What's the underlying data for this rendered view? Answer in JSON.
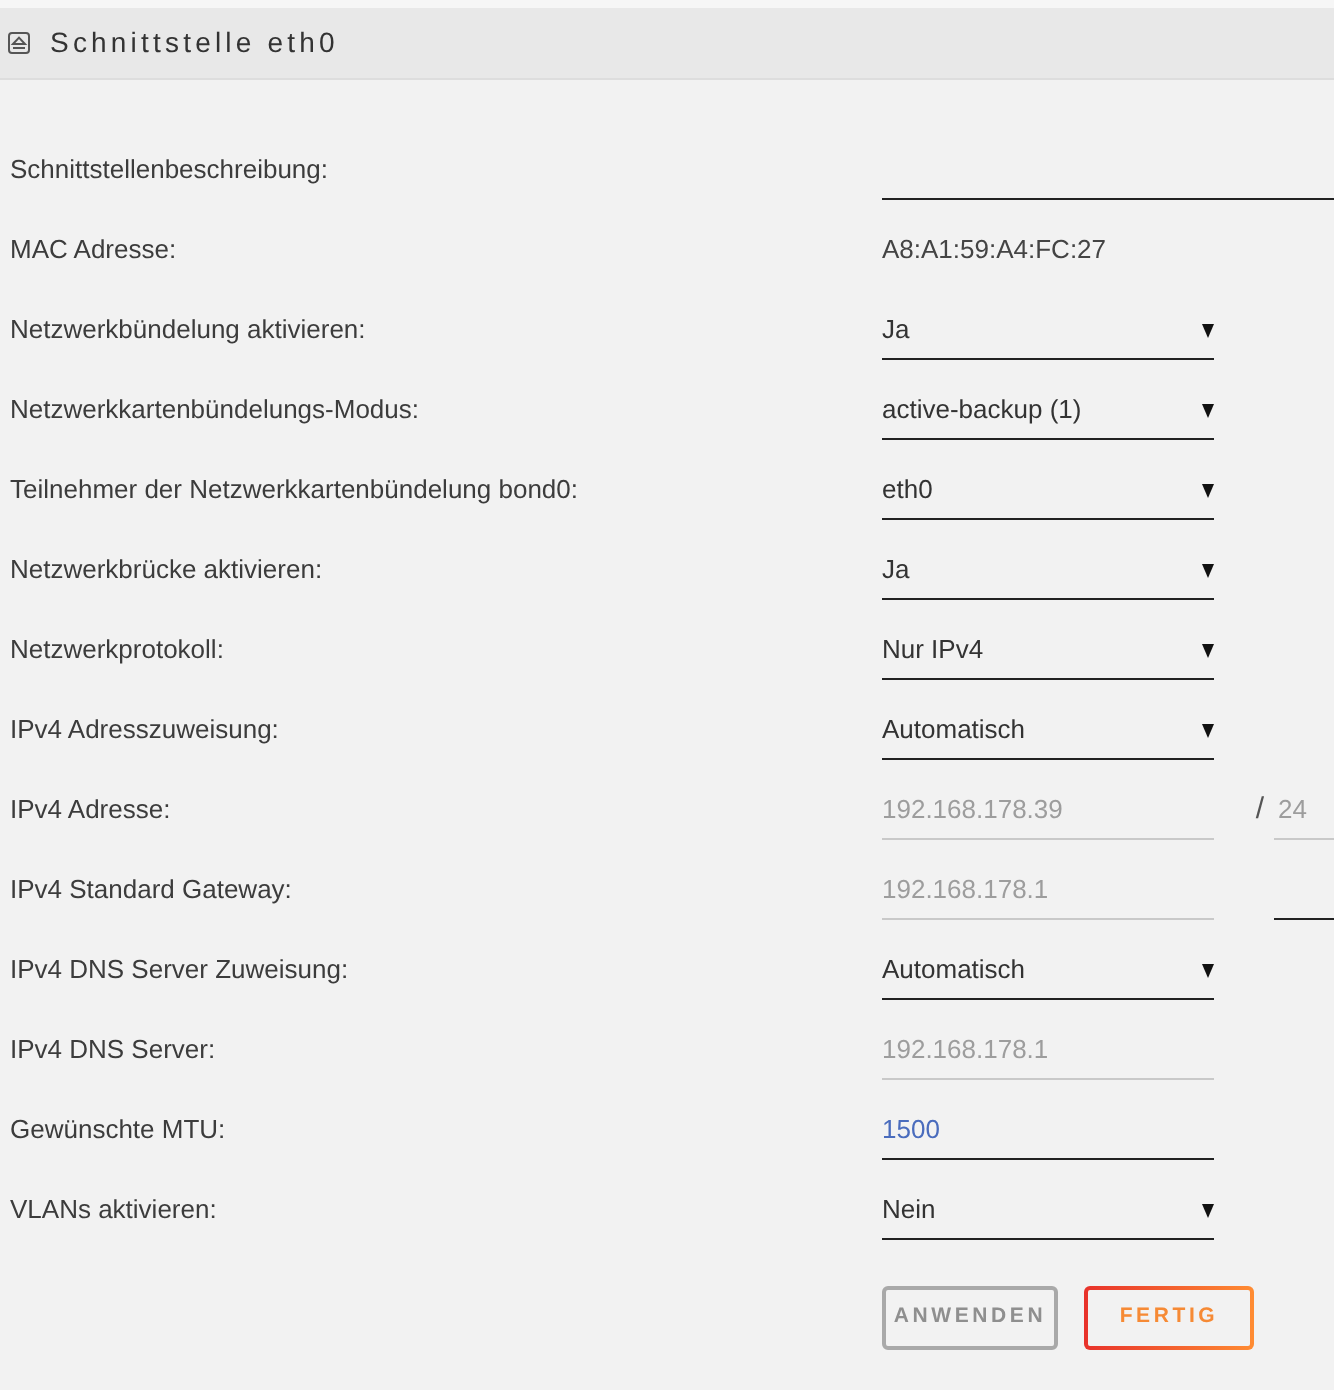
{
  "panel": {
    "title": "Schnittstelle eth0"
  },
  "rows": [
    {
      "label": "Schnittstellenbeschreibung:",
      "kind": "text",
      "disabled": false
    },
    {
      "label": "MAC Adresse:",
      "kind": "static",
      "value": "A8:A1:59:A4:FC:27"
    },
    {
      "label": "Netzwerkbündelung aktivieren:",
      "kind": "select",
      "value": "Ja",
      "disabled": false
    },
    {
      "label": "Netzwerkkartenbündelungs-Modus:",
      "kind": "select",
      "value": "active-backup (1)",
      "disabled": false
    },
    {
      "label": "Teilnehmer der Netzwerkkartenbündelung bond0:",
      "kind": "select",
      "value": "eth0",
      "disabled": false
    },
    {
      "label": "Netzwerkbrücke aktivieren:",
      "kind": "select",
      "value": "Ja",
      "disabled": false
    },
    {
      "label": "Netzwerkprotokoll:",
      "kind": "select",
      "value": "Nur IPv4",
      "disabled": false
    },
    {
      "label": "IPv4 Adresszuweisung:",
      "kind": "select",
      "value": "Automatisch",
      "disabled": false
    },
    {
      "label": "IPv4 Adresse:",
      "kind": "input",
      "value": "192.168.178.39",
      "disabled": true,
      "extra": {
        "separator": "/",
        "value": "24",
        "disabled": true
      }
    },
    {
      "label": "IPv4 Standard Gateway:",
      "kind": "input",
      "value": "192.168.178.1",
      "disabled": true,
      "extra": {
        "disabled": false
      }
    },
    {
      "label": "IPv4 DNS Server Zuweisung:",
      "kind": "select",
      "value": "Automatisch",
      "disabled": false
    },
    {
      "label": "IPv4 DNS Server:",
      "kind": "input",
      "value": "192.168.178.1",
      "disabled": true
    },
    {
      "label": "Gewünschte MTU:",
      "kind": "input",
      "value": "1500",
      "disabled": false
    },
    {
      "label": "VLANs aktivieren:",
      "kind": "select",
      "value": "Nein",
      "disabled": false
    }
  ],
  "buttons": [
    {
      "label": "ANWENDEN",
      "kind": "secondary",
      "disabled": true
    },
    {
      "label": "FERTIG",
      "kind": "primary",
      "disabled": false
    }
  ]
}
